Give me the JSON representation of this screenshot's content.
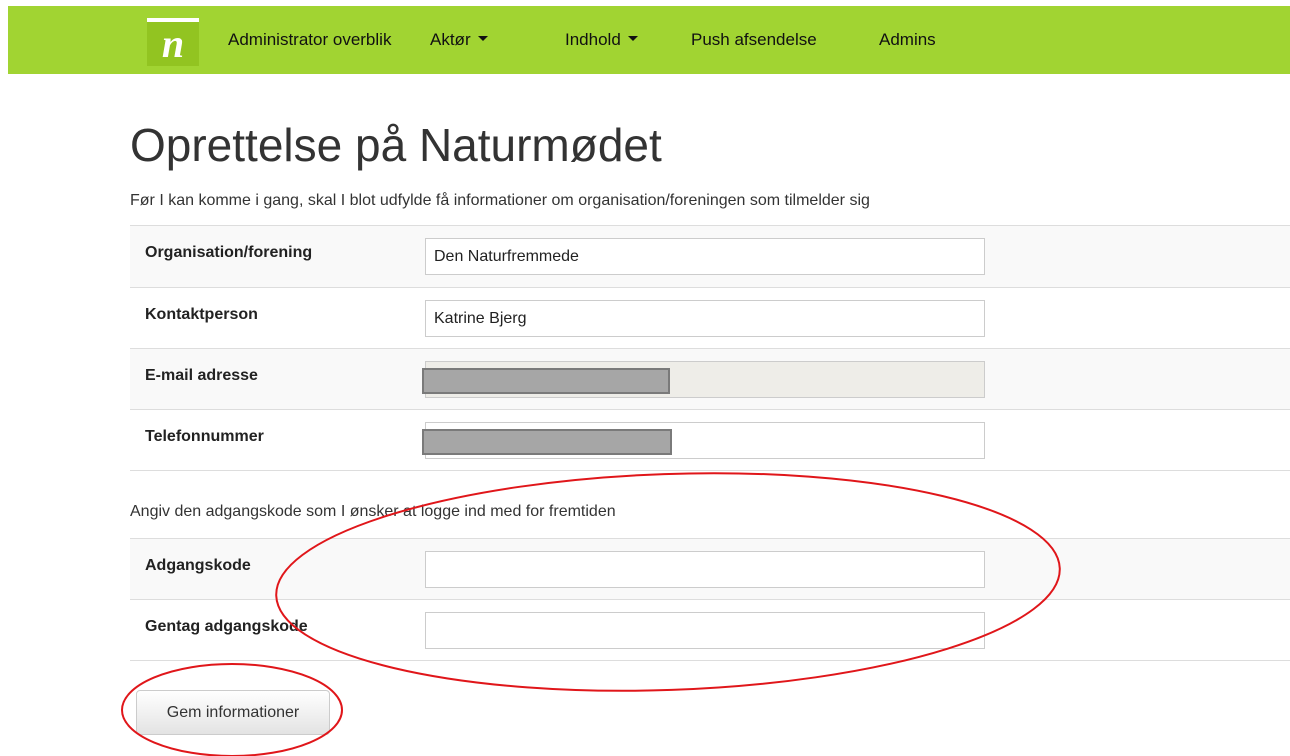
{
  "nav": {
    "logo": "n",
    "items": [
      {
        "label": "Administrator overblik"
      },
      {
        "label": "Aktør"
      },
      {
        "label": "Indhold"
      },
      {
        "label": "Push afsendelse"
      },
      {
        "label": "Admins"
      }
    ]
  },
  "page": {
    "title": "Oprettelse på Naturmødet",
    "intro": "Før I kan komme i gang, skal I blot udfylde få informationer om organisation/foreningen som tilmelder sig"
  },
  "form": {
    "organisation": {
      "label": "Organisation/forening",
      "value": "Den Naturfremmede"
    },
    "contact": {
      "label": "Kontaktperson",
      "value": "Katrine Bjerg"
    },
    "email": {
      "label": "E-mail adresse",
      "value": ""
    },
    "phone": {
      "label": "Telefonnummer",
      "value": ""
    }
  },
  "password_section": {
    "intro": "Angiv den adgangskode som I ønsker at logge ind med for fremtiden",
    "password": {
      "label": "Adgangskode",
      "value": ""
    },
    "repeat": {
      "label": "Gentag adgangskode",
      "value": ""
    }
  },
  "actions": {
    "save_label": "Gem informationer"
  },
  "colors": {
    "navbar": "#a1d432",
    "annotation": "#e0161a"
  }
}
